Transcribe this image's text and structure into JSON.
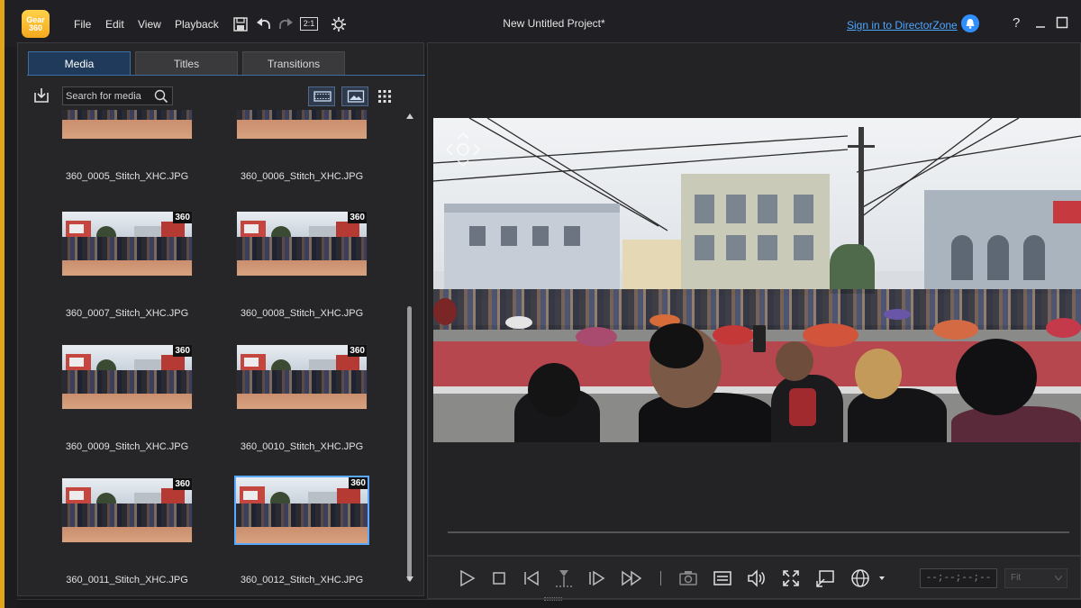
{
  "app": {
    "logo_text": "Gear 360",
    "project_title": "New Untitled Project*",
    "signin_link": "Sign in to DirectorZone",
    "help": "?",
    "accent": "#e1a51a",
    "link_color": "#4da6ff"
  },
  "menu": {
    "file": "File",
    "edit": "Edit",
    "view": "View",
    "playback": "Playback"
  },
  "toolbar_icons": [
    "save-icon",
    "undo-icon",
    "redo-icon",
    "aspect-ratio-icon",
    "settings-icon"
  ],
  "toolbar": {
    "aspect_label": "2:1"
  },
  "tabs": [
    {
      "label": "Media",
      "active": true
    },
    {
      "label": "Titles",
      "active": false
    },
    {
      "label": "Transitions",
      "active": false
    }
  ],
  "search": {
    "placeholder": "Search for media"
  },
  "media": {
    "badge": "360",
    "items": [
      {
        "name": "360_0005_Stitch_XHC.JPG"
      },
      {
        "name": "360_0006_Stitch_XHC.JPG"
      },
      {
        "name": "360_0007_Stitch_XHC.JPG"
      },
      {
        "name": "360_0008_Stitch_XHC.JPG"
      },
      {
        "name": "360_0009_Stitch_XHC.JPG"
      },
      {
        "name": "360_0010_Stitch_XHC.JPG"
      },
      {
        "name": "360_0011_Stitch_XHC.JPG"
      },
      {
        "name": "360_0012_Stitch_XHC.JPG",
        "selected": true
      }
    ]
  },
  "player": {
    "timecode": "--;--;--;--",
    "zoom": "Fit",
    "controls": [
      "play-icon",
      "stop-icon",
      "previous-frame-icon",
      "split-icon",
      "next-frame-icon",
      "fast-forward-icon",
      "snapshot-icon",
      "subtitles-icon",
      "volume-icon",
      "fullscreen-icon",
      "external-display-icon",
      "360-view-icon"
    ]
  }
}
